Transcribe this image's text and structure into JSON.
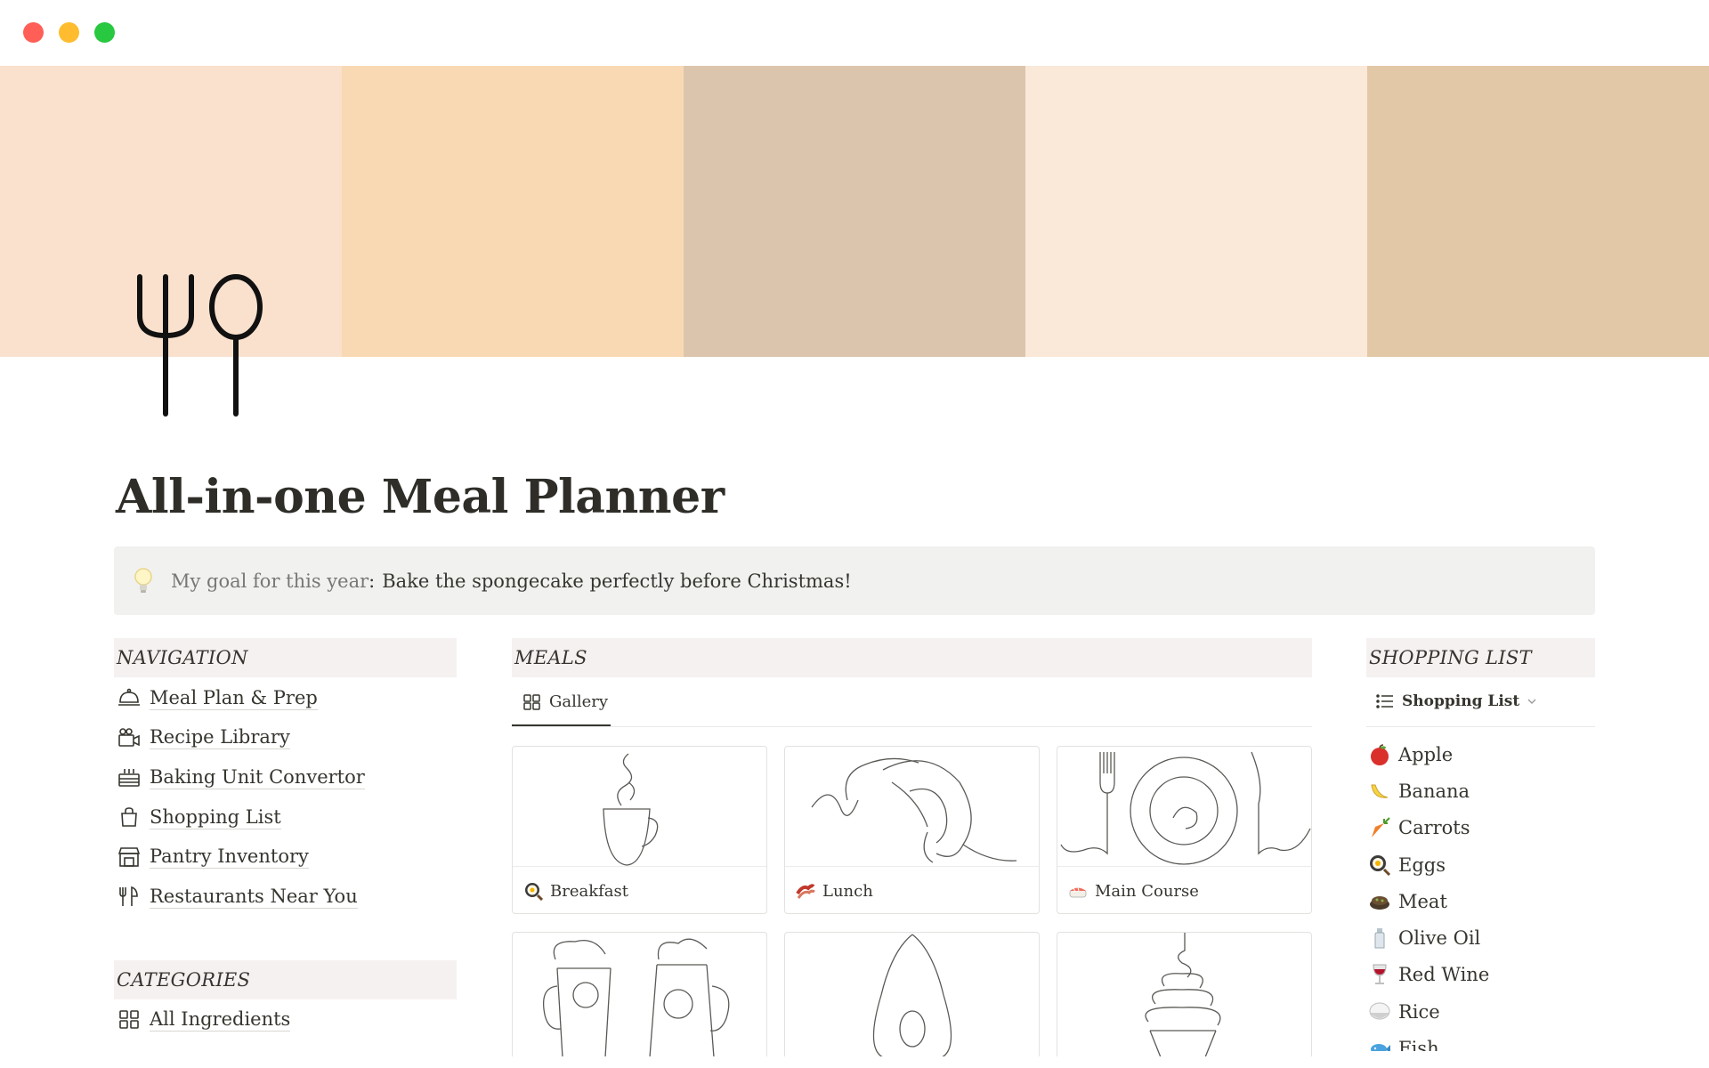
{
  "window": {
    "traffic_lights": [
      "#ff5f57",
      "#febc2e",
      "#28c840"
    ]
  },
  "cover": {
    "stripes": [
      "#f9e1cd",
      "#f8d9b4",
      "#dcc5ad",
      "#fae8d8",
      "#e2c8a6"
    ]
  },
  "page": {
    "title": "All-in-one Meal Planner",
    "icon": "fork-spoon-icon"
  },
  "callout": {
    "icon": "lightbulb-icon",
    "label": "My goal for this year",
    "colon": ":",
    "text": "Bake the spongecake perfectly before Christmas!"
  },
  "navigation": {
    "header": "NAVIGATION",
    "items": [
      {
        "label": "Meal Plan & Prep",
        "icon": "food-cloche-icon"
      },
      {
        "label": "Recipe Library",
        "icon": "video-camera-icon"
      },
      {
        "label": "Baking Unit Convertor",
        "icon": "cake-icon"
      },
      {
        "label": "Shopping List",
        "icon": "shopping-bag-icon"
      },
      {
        "label": "Pantry Inventory",
        "icon": "storefront-icon"
      },
      {
        "label": "Restaurants Near You",
        "icon": "fork-knife-icon"
      }
    ]
  },
  "categories": {
    "header": "CATEGORIES",
    "items": [
      {
        "label": "All Ingredients",
        "icon": "grid-icon"
      }
    ]
  },
  "meals": {
    "header": "MEALS",
    "view_tab": {
      "label": "Gallery",
      "icon": "gallery-grid-icon"
    },
    "cards": [
      {
        "label": "Breakfast",
        "emoji": "cooking-egg-emoji"
      },
      {
        "label": "Lunch",
        "emoji": "bacon-emoji"
      },
      {
        "label": "Main Course",
        "emoji": "sushi-emoji"
      }
    ]
  },
  "shopping": {
    "header": "SHOPPING LIST",
    "view_tab": {
      "label": "Shopping List",
      "icon": "list-icon",
      "chevron": "chevron-down-icon"
    },
    "items": [
      {
        "label": "Apple",
        "emoji": "apple-emoji"
      },
      {
        "label": "Banana",
        "emoji": "banana-emoji"
      },
      {
        "label": "Carrots",
        "emoji": "carrot-emoji"
      },
      {
        "label": "Eggs",
        "emoji": "cooking-egg-emoji"
      },
      {
        "label": "Meat",
        "emoji": "meat-pie-emoji"
      },
      {
        "label": "Olive Oil",
        "emoji": "bottle-emoji"
      },
      {
        "label": "Red Wine",
        "emoji": "wine-glass-emoji"
      },
      {
        "label": "Rice",
        "emoji": "rice-bowl-emoji"
      },
      {
        "label": "Fish",
        "emoji": "fish-emoji"
      }
    ]
  }
}
